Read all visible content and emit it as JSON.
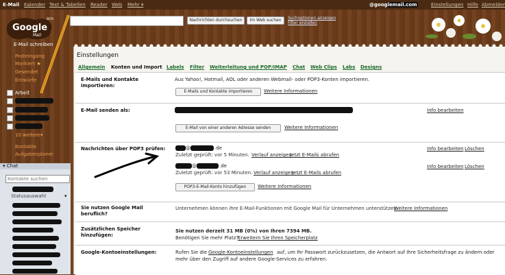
{
  "topbar": {
    "items": [
      "E-Mail",
      "Kalender",
      "Text & Tabellen",
      "Reader",
      "Web",
      "Mehr ▾"
    ],
    "email": "@googlemail.com",
    "right_links": [
      "Einstellungen",
      "Hilfe",
      "Abmelden"
    ]
  },
  "search": {
    "search_mail": "Nachrichten durchsuchen",
    "search_web": "Im Web suchen",
    "opt1": "Suchoptionen anzeigen",
    "opt2": "Filter erstellen"
  },
  "logo": {
    "word": "Google",
    "sub": "Mail",
    "beta": "BETA"
  },
  "nav": {
    "compose": "E-Mail schreiben",
    "items": [
      "Posteingang",
      "Markiert",
      "Gesendet",
      "Entwürfe"
    ],
    "labels": [
      "Arbeit"
    ],
    "more": "10 weitere▾",
    "contacts": "Kontakte",
    "tasks": "Aufgabenplaner"
  },
  "chat": {
    "title": "Chat",
    "search_placeholder": "Kontakte suchen",
    "status": "Statusauswahl"
  },
  "settings": {
    "title": "Einstellungen",
    "tabs": [
      "Allgemein",
      "Konten und Import",
      "Labels",
      "Filter",
      "Weiterleitung und POP/IMAP",
      "Chat",
      "Web Clips",
      "Labs",
      "Designs"
    ],
    "rows": {
      "import": {
        "label": "E-Mails und Kontakte importieren:",
        "text": "Aus Yahoo!, Hotmail, AOL oder anderen Webmail- oder POP3-Konten importieren.",
        "button": "E-Mails und Kontakte importieren",
        "link": "Weitere Informationen"
      },
      "send_as": {
        "label": "E-Mail senden als:",
        "button": "E-Mail von einer anderen Adresse senden",
        "link": "Weitere Informationen",
        "edit": "Info bearbeiten"
      },
      "pop3": {
        "label": "Nachrichten über POP3 prüfen:",
        "accounts": [
          {
            "domain": ".de",
            "status": "Zuletzt geprüft: vor 5 Minuten.",
            "history": "Verlauf anzeigen",
            "check": "Jetzt E-Mails abrufen"
          },
          {
            "domain": ".de",
            "status": "Zuletzt geprüft: vor 53 Minuten.",
            "history": "Verlauf anzeigen",
            "check": "Jetzt E-Mails abrufen"
          }
        ],
        "at": "@",
        "edit": "Info bearbeiten",
        "delete": "Löschen",
        "button": "POP3-E-Mail-Konto hinzufügen",
        "link": "Weitere Informationen"
      },
      "business": {
        "label": "Sie nutzen Google Mail beruflich?",
        "text": "Unternehmen können ihre E-Mail-Funktionen mit Google Mail für Unternehmen unterstützen.",
        "link": "Weitere Informationen"
      },
      "storage": {
        "label": "Zusätzlichen Speicher hinzufügen:",
        "text": "Sie nutzen derzeit 31 MB (0%) von Ihren 7394 MB.",
        "text2": "Benötigen Sie mehr Platz?",
        "link": "Erweitern Sie Ihren Speicherplatz"
      },
      "account": {
        "label": "Google-Kontoeinstellungen:",
        "text_a": "Rufen Sie die",
        "link": "Google-Kontoeinstellungen",
        "text_b": "auf, um Ihr Passwort zurückzusetzen, die Antwort auf Ihre Sicherheitsfrage zu ändern oder",
        "text2": "mehr über den Zugriff auf andere Google-Services zu erfahren."
      }
    }
  },
  "colors": {
    "wood": "#6e3d1a",
    "accent_orange": "#e79a4f",
    "tab_green": "#1b6b2a",
    "link_blue": "#1a3ea8"
  }
}
